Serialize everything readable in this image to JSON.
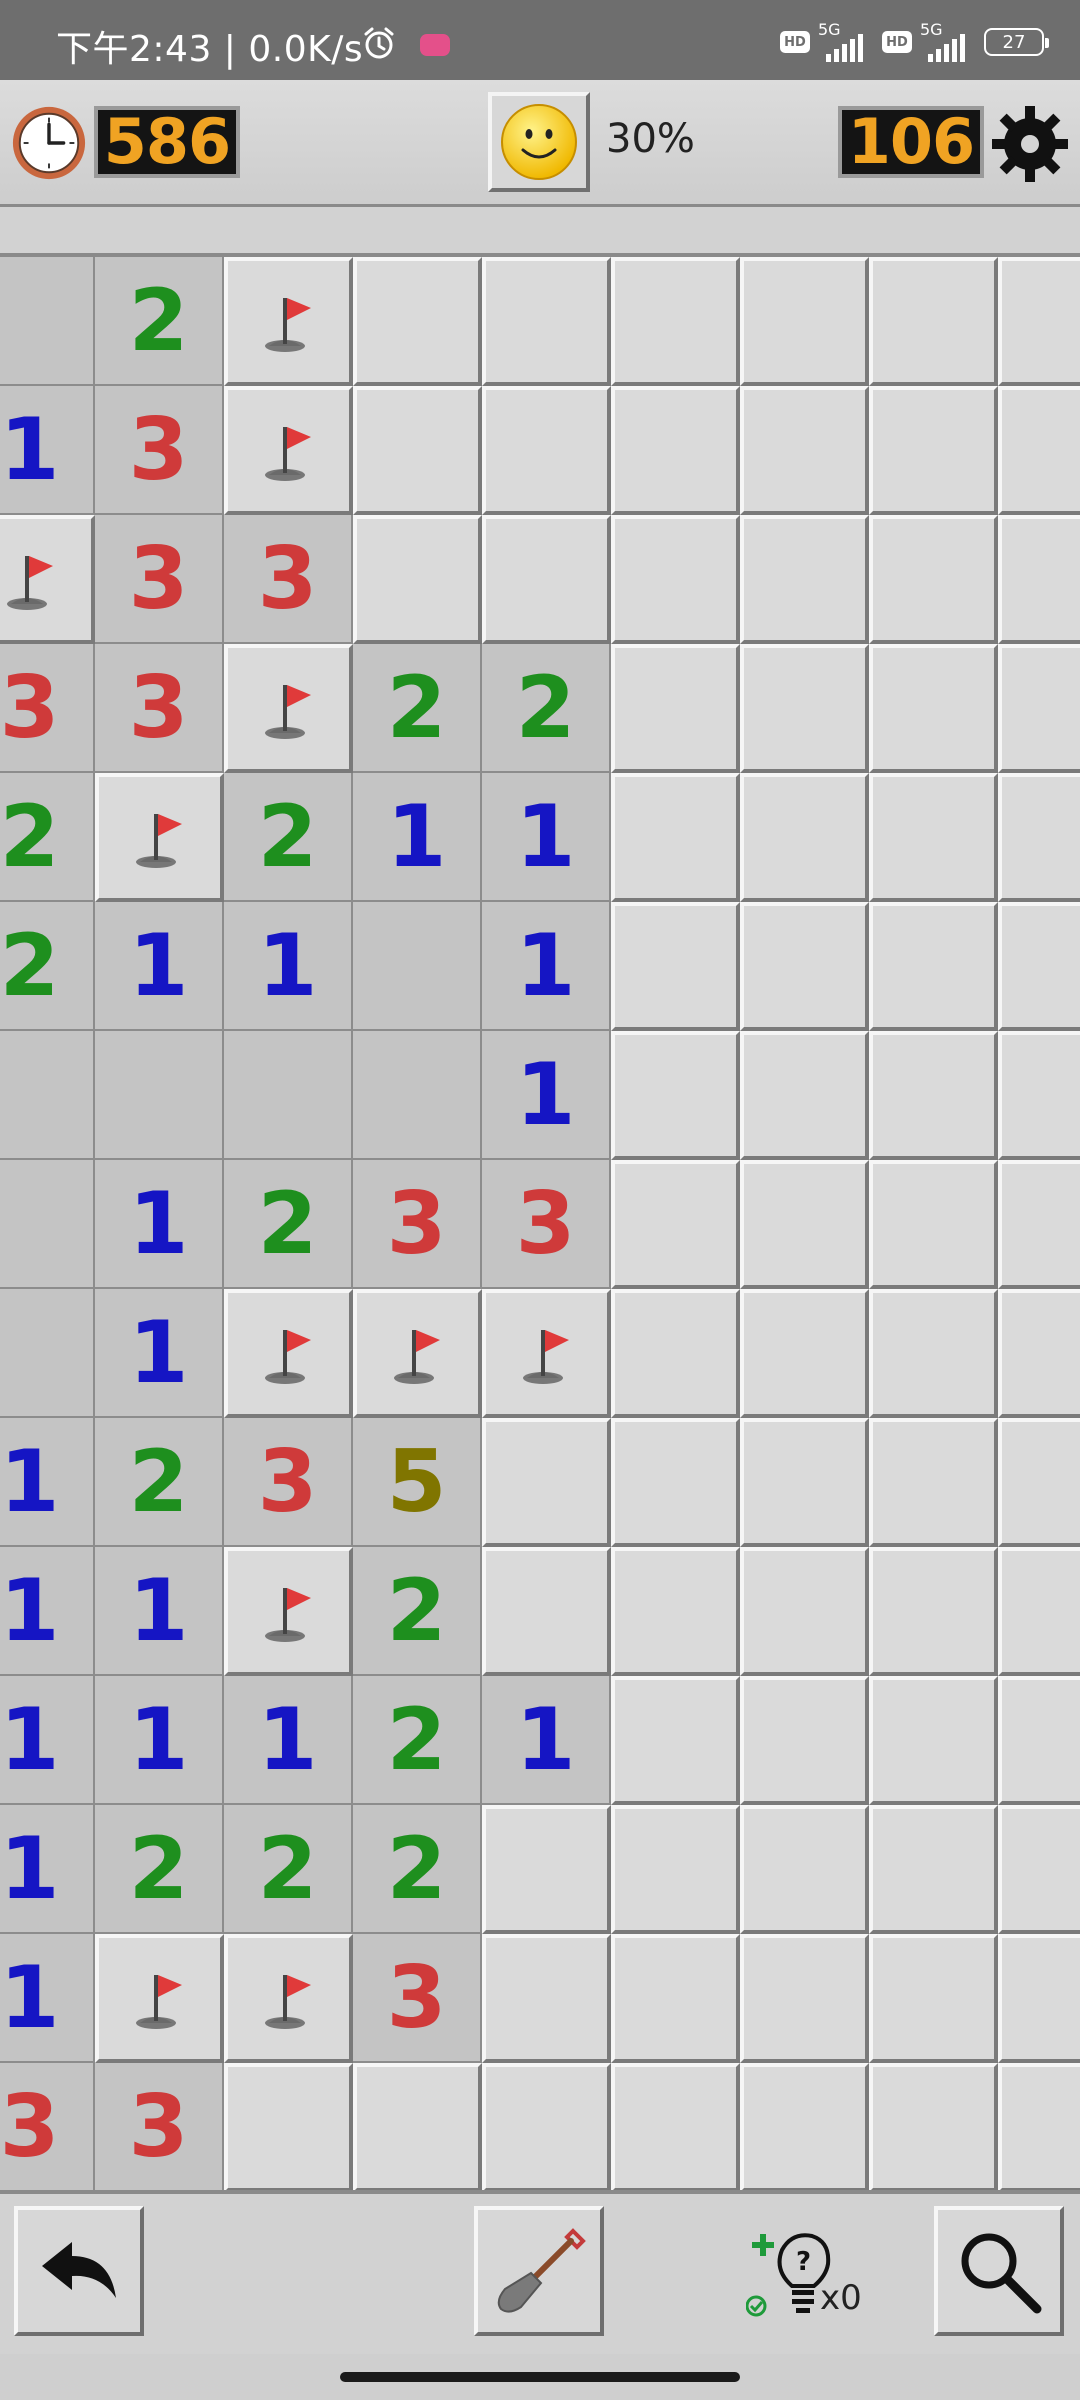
{
  "status_bar": {
    "time": "下午2:43",
    "speed": "0.0K/s",
    "sim1_label": "5G",
    "sim2_label": "5G",
    "hd_label": "HD",
    "battery": "27"
  },
  "header": {
    "timer": "586",
    "mines_left": "106",
    "progress": "30%",
    "face": "smiley-face-icon"
  },
  "board": {
    "cols": 9,
    "rows": 15,
    "cells": [
      [
        "",
        "2",
        "F",
        "H",
        "H",
        "H",
        "H",
        "H",
        "H"
      ],
      [
        "1",
        "3",
        "F",
        "H",
        "H",
        "H",
        "H",
        "H",
        "H"
      ],
      [
        "F",
        "3",
        "3",
        "H",
        "H",
        "H",
        "H",
        "H",
        "H"
      ],
      [
        "3",
        "3",
        "F",
        "2",
        "2",
        "H",
        "H",
        "H",
        "H"
      ],
      [
        "2",
        "F",
        "2",
        "1",
        "1",
        "H",
        "H",
        "H",
        "H"
      ],
      [
        "2",
        "1",
        "1",
        "",
        "1",
        "H",
        "H",
        "H",
        "H"
      ],
      [
        "",
        "",
        "",
        "",
        "1",
        "H",
        "H",
        "H",
        "H"
      ],
      [
        "",
        "1",
        "2",
        "3",
        "3",
        "H",
        "H",
        "H",
        "H"
      ],
      [
        "",
        "1",
        "F",
        "F",
        "F",
        "H",
        "H",
        "H",
        "H"
      ],
      [
        "1",
        "2",
        "3",
        "5",
        "H",
        "H",
        "H",
        "H",
        "H"
      ],
      [
        "1",
        "1",
        "F",
        "2",
        "H",
        "H",
        "H",
        "H",
        "H"
      ],
      [
        "1",
        "1",
        "1",
        "2",
        "1",
        "H",
        "H",
        "H",
        "H"
      ],
      [
        "1",
        "2",
        "2",
        "2",
        "H",
        "H",
        "H",
        "H",
        "H"
      ],
      [
        "1",
        "F",
        "F",
        "3",
        "H",
        "H",
        "H",
        "H",
        "H"
      ],
      [
        "3",
        "3",
        "H",
        "H",
        "H",
        "H",
        "H",
        "H",
        "H"
      ]
    ]
  },
  "toolbar": {
    "hint_count": "x0",
    "undo_icon": "undo-arrow-icon",
    "dig_icon": "shovel-icon",
    "hint_icon": "lightbulb-hint-icon",
    "zoom_icon": "magnifier-icon"
  },
  "colors": {
    "counter_digits": "#f0a323",
    "n1": "#1515c4",
    "n2": "#1e8f1e",
    "n3": "#cf3a3a",
    "n5": "#807500",
    "flag": "#e03a3a"
  }
}
